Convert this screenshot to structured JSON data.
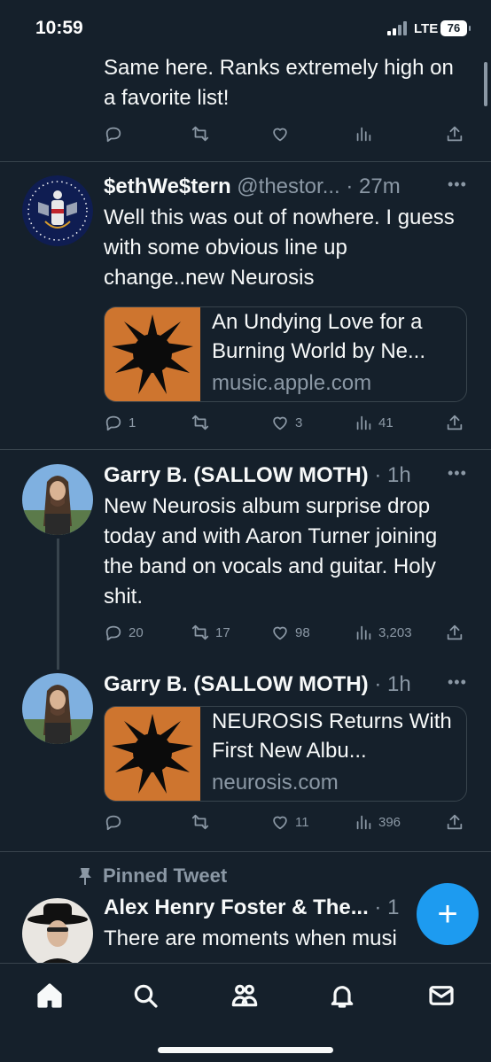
{
  "status_bar": {
    "time": "10:59",
    "network": "LTE",
    "battery": "76"
  },
  "tweets": [
    {
      "text": "Same here. Ranks extremely high on a favorite list!",
      "metrics": {
        "reply": "",
        "retweet": "",
        "like": "",
        "views": ""
      }
    },
    {
      "name": "$ethWe$tern",
      "handle": "@thestor...",
      "time": "· 27m",
      "text": "Well this was out of nowhere. I guess with some obvious line up change..new Neurosis",
      "card": {
        "title": "An Undying Love for a Burning World by Ne...",
        "domain": "music.apple.com"
      },
      "metrics": {
        "reply": "1",
        "retweet": "",
        "like": "3",
        "views": "41"
      }
    },
    {
      "name": "Garry B. (SALLOW MOTH)",
      "time": "· 1h",
      "text": "New Neurosis album surprise drop today and with Aaron Turner joining the band on vocals and guitar. Holy shit.",
      "metrics": {
        "reply": "20",
        "retweet": "17",
        "like": "98",
        "views": "3,203"
      }
    },
    {
      "name": "Garry B. (SALLOW MOTH)",
      "time": "· 1h",
      "card": {
        "title": "NEUROSIS Returns With First New Albu...",
        "domain": "neurosis.com"
      },
      "metrics": {
        "reply": "",
        "retweet": "",
        "like": "11",
        "views": "396"
      }
    },
    {
      "pinned_label": "Pinned Tweet",
      "name": "Alex Henry Foster & The...",
      "time": "· 1",
      "text": "There are moments when musi"
    }
  ],
  "fab": {
    "label": "+"
  },
  "tabbar": [
    "home-icon",
    "search-icon",
    "communities-icon",
    "notifications-icon",
    "messages-icon"
  ]
}
